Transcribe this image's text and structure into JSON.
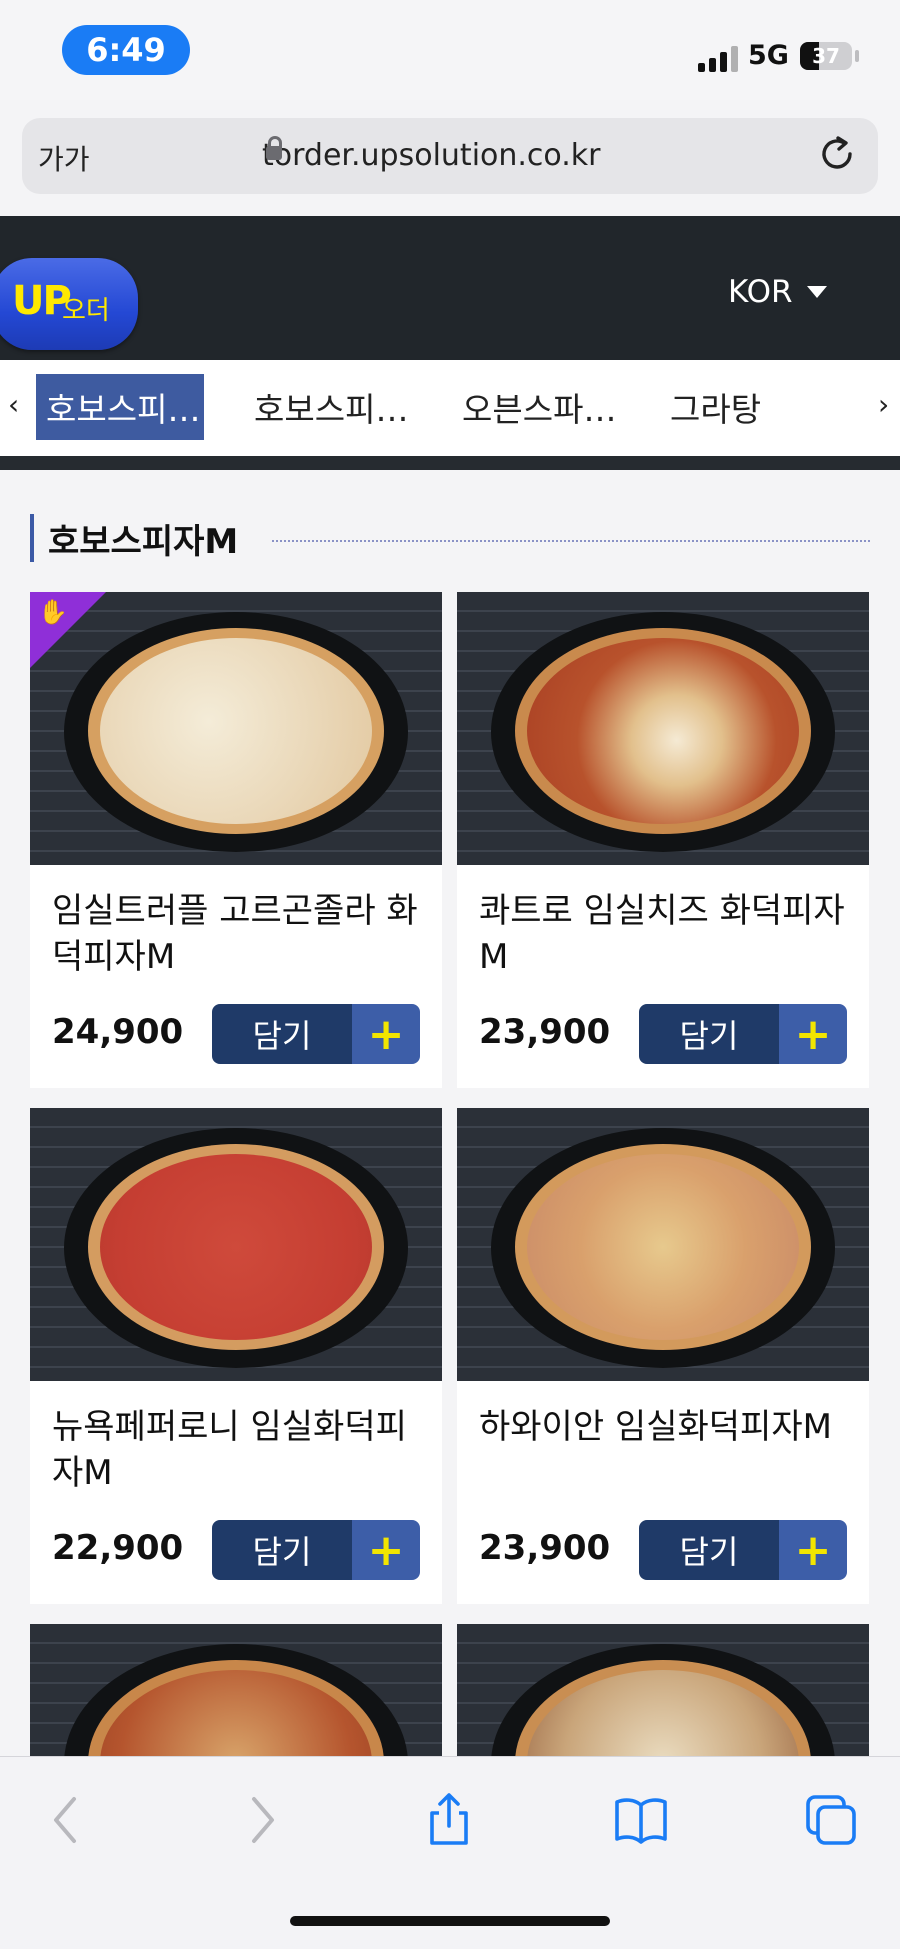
{
  "status_bar": {
    "time": "6:49",
    "network": "5G",
    "battery": "37",
    "battery_level": 0.37
  },
  "browser": {
    "text_size_label": "가가",
    "url": "torder.upsolution.co.kr",
    "icons": [
      "lock-icon",
      "reload-icon",
      "back-icon",
      "forward-icon",
      "share-icon",
      "bookmarks-icon",
      "tabs-icon"
    ]
  },
  "header": {
    "logo_up": "UP",
    "logo_order": "오더",
    "language": "KOR"
  },
  "tabs": {
    "prev": "‹",
    "next": "›",
    "items": [
      "호보스피…",
      "호보스피…",
      "오븐스파…",
      "그라탕"
    ]
  },
  "section": {
    "title": "호보스피자M"
  },
  "products": [
    {
      "name": "임실트러플 고르곤졸라 화덕피자M",
      "price": "24,900",
      "button": "담기",
      "plus": "+"
    },
    {
      "name": "콰트로 임실치즈 화덕피자M",
      "price": "23,900",
      "button": "담기",
      "plus": "+"
    },
    {
      "name": "뉴욕페퍼로니 임실화덕피자M",
      "price": "22,900",
      "button": "담기",
      "plus": "+"
    },
    {
      "name": "하와이안 임실화덕피자M",
      "price": "23,900",
      "button": "담기",
      "plus": "+"
    }
  ],
  "colors": {
    "accent_blue": "#1a7cf5",
    "header_dark": "#21262b",
    "tab_active": "#3e5ba0",
    "button_dark": "#1f3a68",
    "button_plus": "#3d5ea8",
    "plus_yellow": "#f2e500",
    "logo_yellow": "#ffe800",
    "best_badge": "#8f2fd8"
  }
}
